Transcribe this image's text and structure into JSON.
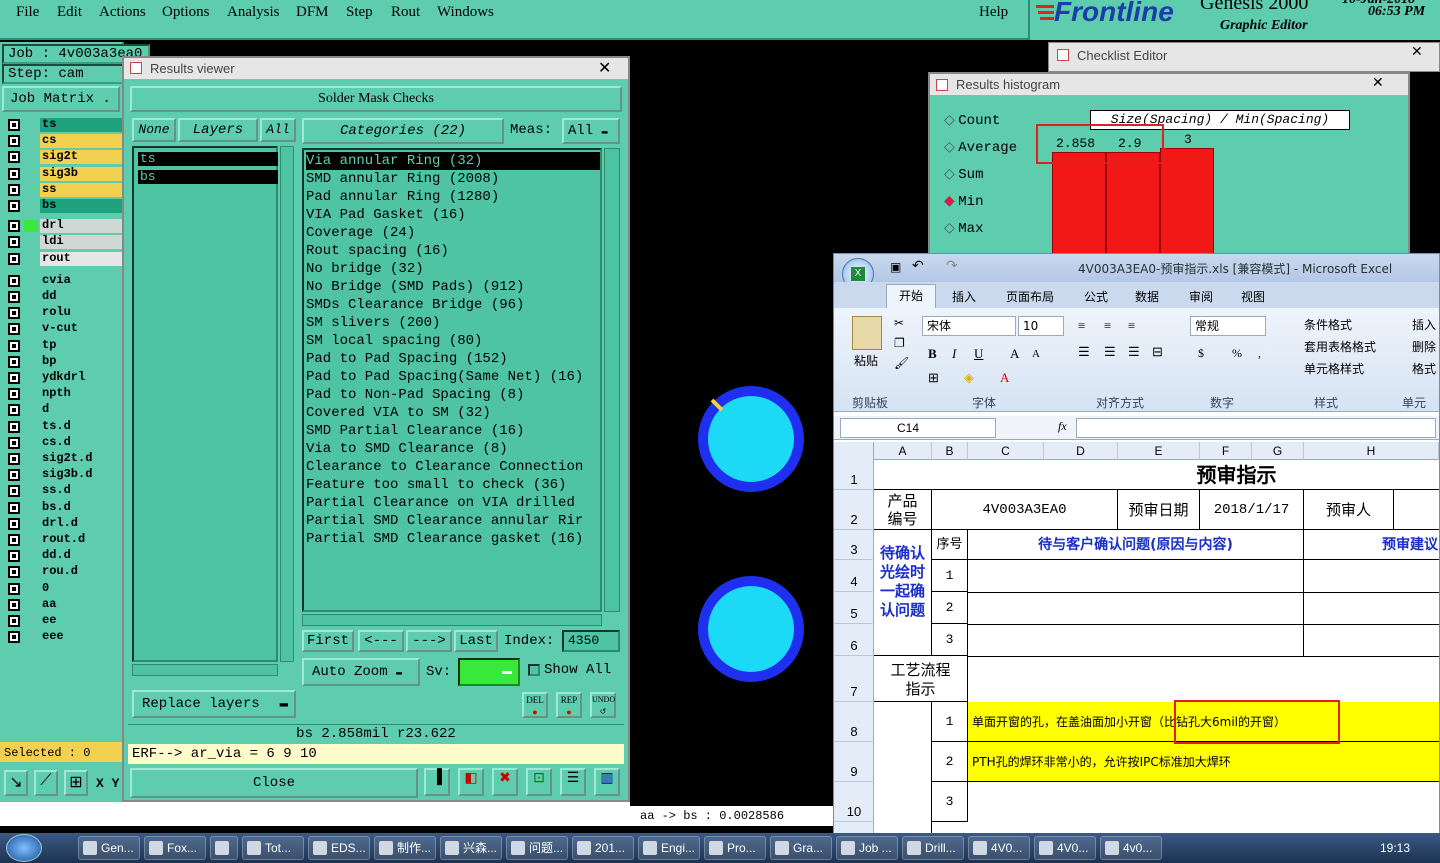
{
  "menu": {
    "items": [
      "File",
      "Edit",
      "Actions",
      "Options",
      "Analysis",
      "DFM",
      "Step",
      "Rout",
      "Windows"
    ],
    "help": "Help"
  },
  "logo": {
    "brand": "Frontline",
    "product": "Genesis 2000",
    "subtitle": "Graphic Editor",
    "time": "06:53 PM",
    "date": "10-Jan-2018"
  },
  "job": {
    "job": "Job : 4v003a3ea0",
    "step": "Step: cam",
    "matrix": "Job Matrix ."
  },
  "layers": [
    {
      "name": "ts",
      "color": "#1fa37f"
    },
    {
      "name": "cs",
      "color": "#f2d050"
    },
    {
      "name": "sig2t",
      "color": "#f2d050"
    },
    {
      "name": "sig3b",
      "color": "#f2d050"
    },
    {
      "name": "ss",
      "color": "#f2d050"
    },
    {
      "name": "bs",
      "color": "#1fa37f"
    },
    {
      "name": "drl",
      "color": "#cfd8d4"
    },
    {
      "name": "ldi",
      "color": "#cfd8d4"
    },
    {
      "name": "rout",
      "color": "#e6e6e6"
    },
    {
      "name": "cvia",
      "color": "#5ecdae"
    },
    {
      "name": "dd",
      "color": "#5ecdae"
    },
    {
      "name": "rolu",
      "color": "#5ecdae"
    },
    {
      "name": "v-cut",
      "color": "#5ecdae"
    },
    {
      "name": "tp",
      "color": "#5ecdae"
    },
    {
      "name": "bp",
      "color": "#5ecdae"
    },
    {
      "name": "ydkdrl",
      "color": "#5ecdae"
    },
    {
      "name": "npth",
      "color": "#5ecdae"
    },
    {
      "name": "d",
      "color": "#5ecdae"
    },
    {
      "name": "ts.d",
      "color": "#5ecdae"
    },
    {
      "name": "cs.d",
      "color": "#5ecdae"
    },
    {
      "name": "sig2t.d",
      "color": "#5ecdae"
    },
    {
      "name": "sig3b.d",
      "color": "#5ecdae"
    },
    {
      "name": "ss.d",
      "color": "#5ecdae"
    },
    {
      "name": "bs.d",
      "color": "#5ecdae"
    },
    {
      "name": "drl.d",
      "color": "#5ecdae"
    },
    {
      "name": "rout.d",
      "color": "#5ecdae"
    },
    {
      "name": "dd.d",
      "color": "#5ecdae"
    },
    {
      "name": "rou.d",
      "color": "#5ecdae"
    },
    {
      "name": "0",
      "color": "#5ecdae"
    },
    {
      "name": "aa",
      "color": "#5ecdae"
    },
    {
      "name": "ee",
      "color": "#5ecdae"
    },
    {
      "name": "eee",
      "color": "#5ecdae"
    }
  ],
  "selected": "Selected : 0",
  "results_viewer": {
    "title": "Results viewer",
    "header": "Solder Mask Checks",
    "none": "None",
    "layers_label": "Layers",
    "all": "All",
    "layer_list": [
      "ts",
      "bs"
    ],
    "categories_label": "Categories (22)",
    "meas_label": "Meas:",
    "meas_value": "All",
    "categories": [
      "Via annular Ring (32)",
      "SMD annular Ring (2008)",
      "Pad annular Ring (1280)",
      "VIA Pad Gasket (16)",
      "Coverage (24)",
      "Rout spacing (16)",
      "No bridge (32)",
      "No Bridge (SMD Pads) (912)",
      "SMDs Clearance Bridge (96)",
      "SM slivers (200)",
      "SM local spacing (80)",
      "Pad to Pad Spacing (152)",
      "Pad to Pad Spacing(Same Net) (16)",
      "Pad to Non-Pad Spacing (8)",
      "Covered VIA to SM (32)",
      "SMD Partial Clearance (16)",
      "Via to SMD Clearance (8)",
      "Clearance to Clearance Connection",
      "Feature too small to check (36)",
      "Partial Clearance on VIA drilled",
      "Partial SMD Clearance annular Rir",
      "Partial SMD Clearance gasket (16)"
    ],
    "first": "First",
    "prev": "<---",
    "next": "--->",
    "last": "Last",
    "index_label": "Index:",
    "index_value": "4350",
    "auto_zoom": "Auto Zoom",
    "sv_label": "Sv:",
    "show_all": "Show All",
    "replace_layers": "Replace layers",
    "del": "DEL",
    "rep": "REP",
    "undo": "UNDO",
    "status": "bs 2.858mil  r23.622",
    "erf": "ERF--> ar_via = 6 9 10",
    "close": "Close"
  },
  "checklist": {
    "title": "Checklist Editor"
  },
  "histogram": {
    "title": "Results histogram",
    "options": [
      "Count",
      "Average",
      "Sum",
      "Min",
      "Max"
    ],
    "selected": "Min",
    "label": "Size(Spacing) / Min(Spacing)",
    "values": [
      "2.858",
      "2.9",
      "3"
    ]
  },
  "canvas": {
    "status": "aa -> bs : 0.0028586"
  },
  "excel": {
    "title": "4V003A3EA0-预审指示.xls [兼容模式] - Microsoft Excel",
    "tabs": [
      "开始",
      "插入",
      "页面布局",
      "公式",
      "数据",
      "审阅",
      "视图"
    ],
    "font_name": "宋体",
    "font_size": "10",
    "number_format": "常规",
    "paste": "粘贴",
    "groups": [
      "剪贴板",
      "字体",
      "对齐方式",
      "数字",
      "样式",
      "单元"
    ],
    "style_items": [
      "条件格式",
      "套用表格格式",
      "单元格样式"
    ],
    "right_items": [
      "插入",
      "删除",
      "格式"
    ],
    "name_box": "C14",
    "fx": "fx",
    "cols": [
      "A",
      "B",
      "C",
      "D",
      "E",
      "F",
      "G",
      "H"
    ],
    "rows": [
      "1",
      "2",
      "3",
      "4",
      "5",
      "6",
      "7",
      "8",
      "9",
      "10"
    ],
    "sheet_title": "预审指示",
    "product_label": "产品编号",
    "product_value": "4V003A3EA0",
    "date_label": "预审日期",
    "date_value": "2018/1/17",
    "reviewer_label": "预审人",
    "seq_label": "序号",
    "issues_label": "待与客户确认问题(原因与内容)",
    "suggest_label": "预审建议",
    "confirm_label": "待确认光绘时一起确认问题",
    "seq": [
      "1",
      "2",
      "3"
    ],
    "process_label": "工艺流程指示",
    "proc_seq": [
      "1",
      "2",
      "3"
    ],
    "proc1": "单面开窗的孔，在盖油面加小开窗（比钻孔大6mil的开窗）",
    "proc2": "PTH孔的焊环非常小的，允许按IPC标准加大焊环"
  },
  "taskbar": {
    "items": [
      "Gen...",
      "Fox...",
      "",
      "Tot...",
      "EDS...",
      "制作...",
      "兴森...",
      "问题...",
      "201...",
      "Engi...",
      "Pro...",
      "Gra...",
      "Job ...",
      "Drill...",
      "4V0...",
      "4V0...",
      "4v0..."
    ],
    "time": "19:13"
  }
}
